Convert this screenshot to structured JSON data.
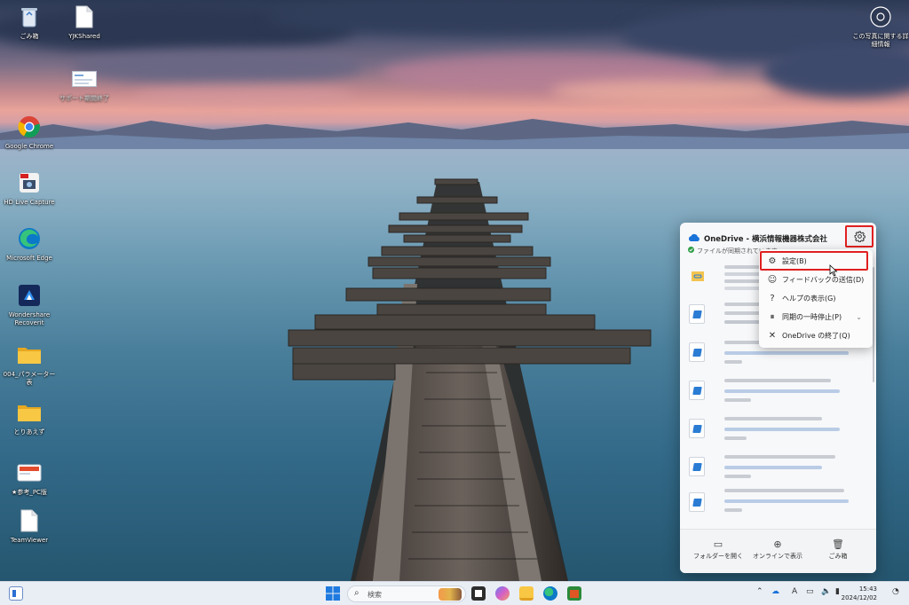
{
  "desktop": {
    "icons": [
      {
        "label": "ごみ箱",
        "icon": "recycle-bin-icon"
      },
      {
        "label": "YJKShared",
        "icon": "file-icon"
      },
      {
        "label": "サポート期間終了",
        "icon": "document-thumbnail-icon"
      },
      {
        "label": "Google Chrome",
        "icon": "chrome-icon"
      },
      {
        "label": "HD Live Capture",
        "icon": "capture-app-icon"
      },
      {
        "label": "Microsoft Edge",
        "icon": "edge-icon"
      },
      {
        "label": "Wondershare\nRecoverit",
        "icon": "recoverit-icon"
      },
      {
        "label": "004_パラメーター\n表",
        "icon": "folder-icon"
      },
      {
        "label": "とりあえず",
        "icon": "folder-icon"
      },
      {
        "label": "★参考_PC版",
        "icon": "shortcut-icon"
      },
      {
        "label": "TeamViewer",
        "icon": "file-icon"
      }
    ],
    "corner_info": {
      "label": "この写真に関する詳\n細情報",
      "icon": "camera-info-icon"
    }
  },
  "onedrive": {
    "title": "OneDrive - 横浜情報機器株式会社",
    "status": "ファイルが同期されています",
    "status_color": "#2e9d47",
    "settings_icon": "gear-icon",
    "footer": [
      {
        "label": "フォルダーを開く",
        "icon": "folder-outline-icon"
      },
      {
        "label": "オンラインで表示",
        "icon": "globe-icon"
      },
      {
        "label": "ごみ箱",
        "icon": "trash-icon"
      }
    ]
  },
  "context_menu": {
    "items": [
      {
        "label": "設定(B)",
        "icon": "gear-icon",
        "has_submenu": false
      },
      {
        "label": "フィードバックの送信(D)",
        "icon": "feedback-icon",
        "has_submenu": false
      },
      {
        "label": "ヘルプの表示(G)",
        "icon": "help-icon",
        "has_submenu": false
      },
      {
        "label": "同期の一時停止(P)",
        "icon": "pause-icon",
        "has_submenu": true
      },
      {
        "label": "OneDrive の終了(Q)",
        "icon": "close-icon",
        "has_submenu": false
      }
    ],
    "highlight_color": "#e02020"
  },
  "taskbar": {
    "search_placeholder": "検索",
    "clock_time": "15:43",
    "clock_date": "2024/12/02",
    "ime_indicator": "A"
  }
}
